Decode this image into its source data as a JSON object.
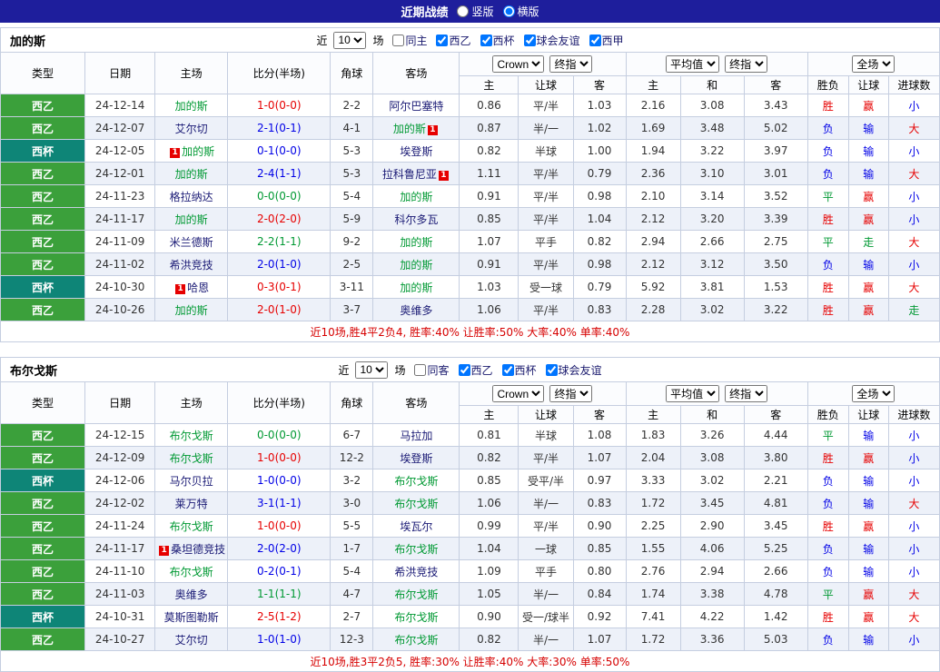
{
  "colors": {
    "topbar_bg": "#1e1e9c",
    "grid": "#c5cee0",
    "league_green": "#3ba03b",
    "league_cup": "#0e8577",
    "focal_team": "#009933",
    "opponent": "#1a1a75",
    "win_red": "#e60000",
    "loss_blue": "#0000e6",
    "draw_green": "#009933",
    "summary_red": "#d60000"
  },
  "topbar": {
    "title": "近期战绩",
    "radios": [
      {
        "label": "竖版",
        "checked": false
      },
      {
        "label": "横版",
        "checked": true
      }
    ]
  },
  "columns": {
    "type": "类型",
    "date": "日期",
    "home": "主场",
    "score": "比分(半场)",
    "corner": "角球",
    "away": "客场",
    "odds_sub": [
      "主",
      "让球",
      "客"
    ],
    "avg_sub": [
      "主",
      "和",
      "客"
    ],
    "result_sub": [
      "胜负",
      "让球",
      "进球数"
    ],
    "selects": {
      "source": "Crown",
      "stage1": "终指",
      "average": "平均值",
      "stage2": "终指",
      "scope": "全场"
    }
  },
  "sections": [
    {
      "team": "加的斯",
      "filter": {
        "prefix": "近",
        "count": "10",
        "suffix": "场",
        "checkboxes": [
          {
            "label": "同主",
            "checked": false
          },
          {
            "label": "西乙",
            "checked": true
          },
          {
            "label": "西杯",
            "checked": true
          },
          {
            "label": "球会友谊",
            "checked": true
          },
          {
            "label": "西甲",
            "checked": true
          }
        ]
      },
      "rows": [
        {
          "lg": "西乙",
          "lg_c": "lg-green",
          "date": "24-12-14",
          "home": {
            "name": "加的斯",
            "focal": true
          },
          "score": "1-0(0-0)",
          "sc_c": "red",
          "corner": "2-2",
          "away": {
            "name": "阿尔巴塞特",
            "focal": false
          },
          "ah": [
            "0.86",
            "平/半",
            "1.03"
          ],
          "eu": [
            "2.16",
            "3.08",
            "3.43"
          ],
          "res": [
            {
              "t": "胜",
              "c": "red"
            },
            {
              "t": "赢",
              "c": "red"
            },
            {
              "t": "小",
              "c": "blue"
            }
          ]
        },
        {
          "lg": "西乙",
          "lg_c": "lg-green",
          "date": "24-12-07",
          "home": {
            "name": "艾尔切",
            "focal": false
          },
          "score": "2-1(0-1)",
          "sc_c": "blue",
          "corner": "4-1",
          "away": {
            "name": "加的斯",
            "focal": true,
            "rc": "after"
          },
          "ah": [
            "0.87",
            "半/一",
            "1.02"
          ],
          "eu": [
            "1.69",
            "3.48",
            "5.02"
          ],
          "res": [
            {
              "t": "负",
              "c": "blue"
            },
            {
              "t": "输",
              "c": "blue"
            },
            {
              "t": "大",
              "c": "red"
            }
          ]
        },
        {
          "lg": "西杯",
          "lg_c": "lg-teal",
          "date": "24-12-05",
          "home": {
            "name": "加的斯",
            "focal": true,
            "rc": "before"
          },
          "score": "0-1(0-0)",
          "sc_c": "blue",
          "corner": "5-3",
          "away": {
            "name": "埃登斯",
            "focal": false
          },
          "ah": [
            "0.82",
            "半球",
            "1.00"
          ],
          "eu": [
            "1.94",
            "3.22",
            "3.97"
          ],
          "res": [
            {
              "t": "负",
              "c": "blue"
            },
            {
              "t": "输",
              "c": "blue"
            },
            {
              "t": "小",
              "c": "blue"
            }
          ]
        },
        {
          "lg": "西乙",
          "lg_c": "lg-green",
          "date": "24-12-01",
          "home": {
            "name": "加的斯",
            "focal": true
          },
          "score": "2-4(1-1)",
          "sc_c": "blue",
          "corner": "5-3",
          "away": {
            "name": "拉科鲁尼亚",
            "focal": false,
            "rc": "after"
          },
          "ah": [
            "1.11",
            "平/半",
            "0.79"
          ],
          "eu": [
            "2.36",
            "3.10",
            "3.01"
          ],
          "res": [
            {
              "t": "负",
              "c": "blue"
            },
            {
              "t": "输",
              "c": "blue"
            },
            {
              "t": "大",
              "c": "red"
            }
          ]
        },
        {
          "lg": "西乙",
          "lg_c": "lg-green",
          "date": "24-11-23",
          "home": {
            "name": "格拉纳达",
            "focal": false
          },
          "score": "0-0(0-0)",
          "sc_c": "green",
          "corner": "5-4",
          "away": {
            "name": "加的斯",
            "focal": true
          },
          "ah": [
            "0.91",
            "平/半",
            "0.98"
          ],
          "eu": [
            "2.10",
            "3.14",
            "3.52"
          ],
          "res": [
            {
              "t": "平",
              "c": "green"
            },
            {
              "t": "赢",
              "c": "red"
            },
            {
              "t": "小",
              "c": "blue"
            }
          ]
        },
        {
          "lg": "西乙",
          "lg_c": "lg-green",
          "date": "24-11-17",
          "home": {
            "name": "加的斯",
            "focal": true
          },
          "score": "2-0(2-0)",
          "sc_c": "red",
          "corner": "5-9",
          "away": {
            "name": "科尔多瓦",
            "focal": false
          },
          "ah": [
            "0.85",
            "平/半",
            "1.04"
          ],
          "eu": [
            "2.12",
            "3.20",
            "3.39"
          ],
          "res": [
            {
              "t": "胜",
              "c": "red"
            },
            {
              "t": "赢",
              "c": "red"
            },
            {
              "t": "小",
              "c": "blue"
            }
          ]
        },
        {
          "lg": "西乙",
          "lg_c": "lg-green",
          "date": "24-11-09",
          "home": {
            "name": "米兰德斯",
            "focal": false
          },
          "score": "2-2(1-1)",
          "sc_c": "green",
          "corner": "9-2",
          "away": {
            "name": "加的斯",
            "focal": true
          },
          "ah": [
            "1.07",
            "平手",
            "0.82"
          ],
          "eu": [
            "2.94",
            "2.66",
            "2.75"
          ],
          "res": [
            {
              "t": "平",
              "c": "green"
            },
            {
              "t": "走",
              "c": "green"
            },
            {
              "t": "大",
              "c": "red"
            }
          ]
        },
        {
          "lg": "西乙",
          "lg_c": "lg-green",
          "date": "24-11-02",
          "home": {
            "name": "希洪竞技",
            "focal": false
          },
          "score": "2-0(1-0)",
          "sc_c": "blue",
          "corner": "2-5",
          "away": {
            "name": "加的斯",
            "focal": true
          },
          "ah": [
            "0.91",
            "平/半",
            "0.98"
          ],
          "eu": [
            "2.12",
            "3.12",
            "3.50"
          ],
          "res": [
            {
              "t": "负",
              "c": "blue"
            },
            {
              "t": "输",
              "c": "blue"
            },
            {
              "t": "小",
              "c": "blue"
            }
          ]
        },
        {
          "lg": "西杯",
          "lg_c": "lg-teal",
          "date": "24-10-30",
          "home": {
            "name": "哈恩",
            "focal": false,
            "rc": "before"
          },
          "score": "0-3(0-1)",
          "sc_c": "red",
          "corner": "3-11",
          "away": {
            "name": "加的斯",
            "focal": true
          },
          "ah": [
            "1.03",
            "受一球",
            "0.79"
          ],
          "eu": [
            "5.92",
            "3.81",
            "1.53"
          ],
          "res": [
            {
              "t": "胜",
              "c": "red"
            },
            {
              "t": "赢",
              "c": "red"
            },
            {
              "t": "大",
              "c": "red"
            }
          ]
        },
        {
          "lg": "西乙",
          "lg_c": "lg-green",
          "date": "24-10-26",
          "home": {
            "name": "加的斯",
            "focal": true
          },
          "score": "2-0(1-0)",
          "sc_c": "red",
          "corner": "3-7",
          "away": {
            "name": "奥维多",
            "focal": false
          },
          "ah": [
            "1.06",
            "平/半",
            "0.83"
          ],
          "eu": [
            "2.28",
            "3.02",
            "3.22"
          ],
          "res": [
            {
              "t": "胜",
              "c": "red"
            },
            {
              "t": "赢",
              "c": "red"
            },
            {
              "t": "走",
              "c": "green"
            }
          ]
        }
      ],
      "summary": "近10场,胜4平2负4, 胜率:40% 让胜率:50% 大率:40% 单率:40%"
    },
    {
      "team": "布尔戈斯",
      "filter": {
        "prefix": "近",
        "count": "10",
        "suffix": "场",
        "checkboxes": [
          {
            "label": "同客",
            "checked": false
          },
          {
            "label": "西乙",
            "checked": true
          },
          {
            "label": "西杯",
            "checked": true
          },
          {
            "label": "球会友谊",
            "checked": true
          }
        ]
      },
      "rows": [
        {
          "lg": "西乙",
          "lg_c": "lg-green",
          "date": "24-12-15",
          "home": {
            "name": "布尔戈斯",
            "focal": true
          },
          "score": "0-0(0-0)",
          "sc_c": "green",
          "corner": "6-7",
          "away": {
            "name": "马拉加",
            "focal": false
          },
          "ah": [
            "0.81",
            "半球",
            "1.08"
          ],
          "eu": [
            "1.83",
            "3.26",
            "4.44"
          ],
          "res": [
            {
              "t": "平",
              "c": "green"
            },
            {
              "t": "输",
              "c": "blue"
            },
            {
              "t": "小",
              "c": "blue"
            }
          ]
        },
        {
          "lg": "西乙",
          "lg_c": "lg-green",
          "date": "24-12-09",
          "home": {
            "name": "布尔戈斯",
            "focal": true
          },
          "score": "1-0(0-0)",
          "sc_c": "red",
          "corner": "12-2",
          "away": {
            "name": "埃登斯",
            "focal": false
          },
          "ah": [
            "0.82",
            "平/半",
            "1.07"
          ],
          "eu": [
            "2.04",
            "3.08",
            "3.80"
          ],
          "res": [
            {
              "t": "胜",
              "c": "red"
            },
            {
              "t": "赢",
              "c": "red"
            },
            {
              "t": "小",
              "c": "blue"
            }
          ]
        },
        {
          "lg": "西杯",
          "lg_c": "lg-teal",
          "date": "24-12-06",
          "home": {
            "name": "马尔贝拉",
            "focal": false
          },
          "score": "1-0(0-0)",
          "sc_c": "blue",
          "corner": "3-2",
          "away": {
            "name": "布尔戈斯",
            "focal": true
          },
          "ah": [
            "0.85",
            "受平/半",
            "0.97"
          ],
          "eu": [
            "3.33",
            "3.02",
            "2.21"
          ],
          "res": [
            {
              "t": "负",
              "c": "blue"
            },
            {
              "t": "输",
              "c": "blue"
            },
            {
              "t": "小",
              "c": "blue"
            }
          ]
        },
        {
          "lg": "西乙",
          "lg_c": "lg-green",
          "date": "24-12-02",
          "home": {
            "name": "莱万特",
            "focal": false
          },
          "score": "3-1(1-1)",
          "sc_c": "blue",
          "corner": "3-0",
          "away": {
            "name": "布尔戈斯",
            "focal": true
          },
          "ah": [
            "1.06",
            "半/一",
            "0.83"
          ],
          "eu": [
            "1.72",
            "3.45",
            "4.81"
          ],
          "res": [
            {
              "t": "负",
              "c": "blue"
            },
            {
              "t": "输",
              "c": "blue"
            },
            {
              "t": "大",
              "c": "red"
            }
          ]
        },
        {
          "lg": "西乙",
          "lg_c": "lg-green",
          "date": "24-11-24",
          "home": {
            "name": "布尔戈斯",
            "focal": true
          },
          "score": "1-0(0-0)",
          "sc_c": "red",
          "corner": "5-5",
          "away": {
            "name": "埃瓦尔",
            "focal": false
          },
          "ah": [
            "0.99",
            "平/半",
            "0.90"
          ],
          "eu": [
            "2.25",
            "2.90",
            "3.45"
          ],
          "res": [
            {
              "t": "胜",
              "c": "red"
            },
            {
              "t": "赢",
              "c": "red"
            },
            {
              "t": "小",
              "c": "blue"
            }
          ]
        },
        {
          "lg": "西乙",
          "lg_c": "lg-green",
          "date": "24-11-17",
          "home": {
            "name": "桑坦德竞技",
            "focal": false,
            "rc": "before"
          },
          "score": "2-0(2-0)",
          "sc_c": "blue",
          "corner": "1-7",
          "away": {
            "name": "布尔戈斯",
            "focal": true
          },
          "ah": [
            "1.04",
            "一球",
            "0.85"
          ],
          "eu": [
            "1.55",
            "4.06",
            "5.25"
          ],
          "res": [
            {
              "t": "负",
              "c": "blue"
            },
            {
              "t": "输",
              "c": "blue"
            },
            {
              "t": "小",
              "c": "blue"
            }
          ]
        },
        {
          "lg": "西乙",
          "lg_c": "lg-green",
          "date": "24-11-10",
          "home": {
            "name": "布尔戈斯",
            "focal": true
          },
          "score": "0-2(0-1)",
          "sc_c": "blue",
          "corner": "5-4",
          "away": {
            "name": "希洪竞技",
            "focal": false
          },
          "ah": [
            "1.09",
            "平手",
            "0.80"
          ],
          "eu": [
            "2.76",
            "2.94",
            "2.66"
          ],
          "res": [
            {
              "t": "负",
              "c": "blue"
            },
            {
              "t": "输",
              "c": "blue"
            },
            {
              "t": "小",
              "c": "blue"
            }
          ]
        },
        {
          "lg": "西乙",
          "lg_c": "lg-green",
          "date": "24-11-03",
          "home": {
            "name": "奥维多",
            "focal": false
          },
          "score": "1-1(1-1)",
          "sc_c": "green",
          "corner": "4-7",
          "away": {
            "name": "布尔戈斯",
            "focal": true
          },
          "ah": [
            "1.05",
            "半/一",
            "0.84"
          ],
          "eu": [
            "1.74",
            "3.38",
            "4.78"
          ],
          "res": [
            {
              "t": "平",
              "c": "green"
            },
            {
              "t": "赢",
              "c": "red"
            },
            {
              "t": "大",
              "c": "red"
            }
          ]
        },
        {
          "lg": "西杯",
          "lg_c": "lg-teal",
          "date": "24-10-31",
          "home": {
            "name": "莫斯图勒斯",
            "focal": false
          },
          "score": "2-5(1-2)",
          "sc_c": "red",
          "corner": "2-7",
          "away": {
            "name": "布尔戈斯",
            "focal": true
          },
          "ah": [
            "0.90",
            "受一/球半",
            "0.92"
          ],
          "eu": [
            "7.41",
            "4.22",
            "1.42"
          ],
          "res": [
            {
              "t": "胜",
              "c": "red"
            },
            {
              "t": "赢",
              "c": "red"
            },
            {
              "t": "大",
              "c": "red"
            }
          ]
        },
        {
          "lg": "西乙",
          "lg_c": "lg-green",
          "date": "24-10-27",
          "home": {
            "name": "艾尔切",
            "focal": false
          },
          "score": "1-0(1-0)",
          "sc_c": "blue",
          "corner": "12-3",
          "away": {
            "name": "布尔戈斯",
            "focal": true
          },
          "ah": [
            "0.82",
            "半/一",
            "1.07"
          ],
          "eu": [
            "1.72",
            "3.36",
            "5.03"
          ],
          "res": [
            {
              "t": "负",
              "c": "blue"
            },
            {
              "t": "输",
              "c": "blue"
            },
            {
              "t": "小",
              "c": "blue"
            }
          ]
        }
      ],
      "summary": "近10场,胜3平2负5, 胜率:30% 让胜率:40% 大率:30% 单率:50%"
    }
  ]
}
